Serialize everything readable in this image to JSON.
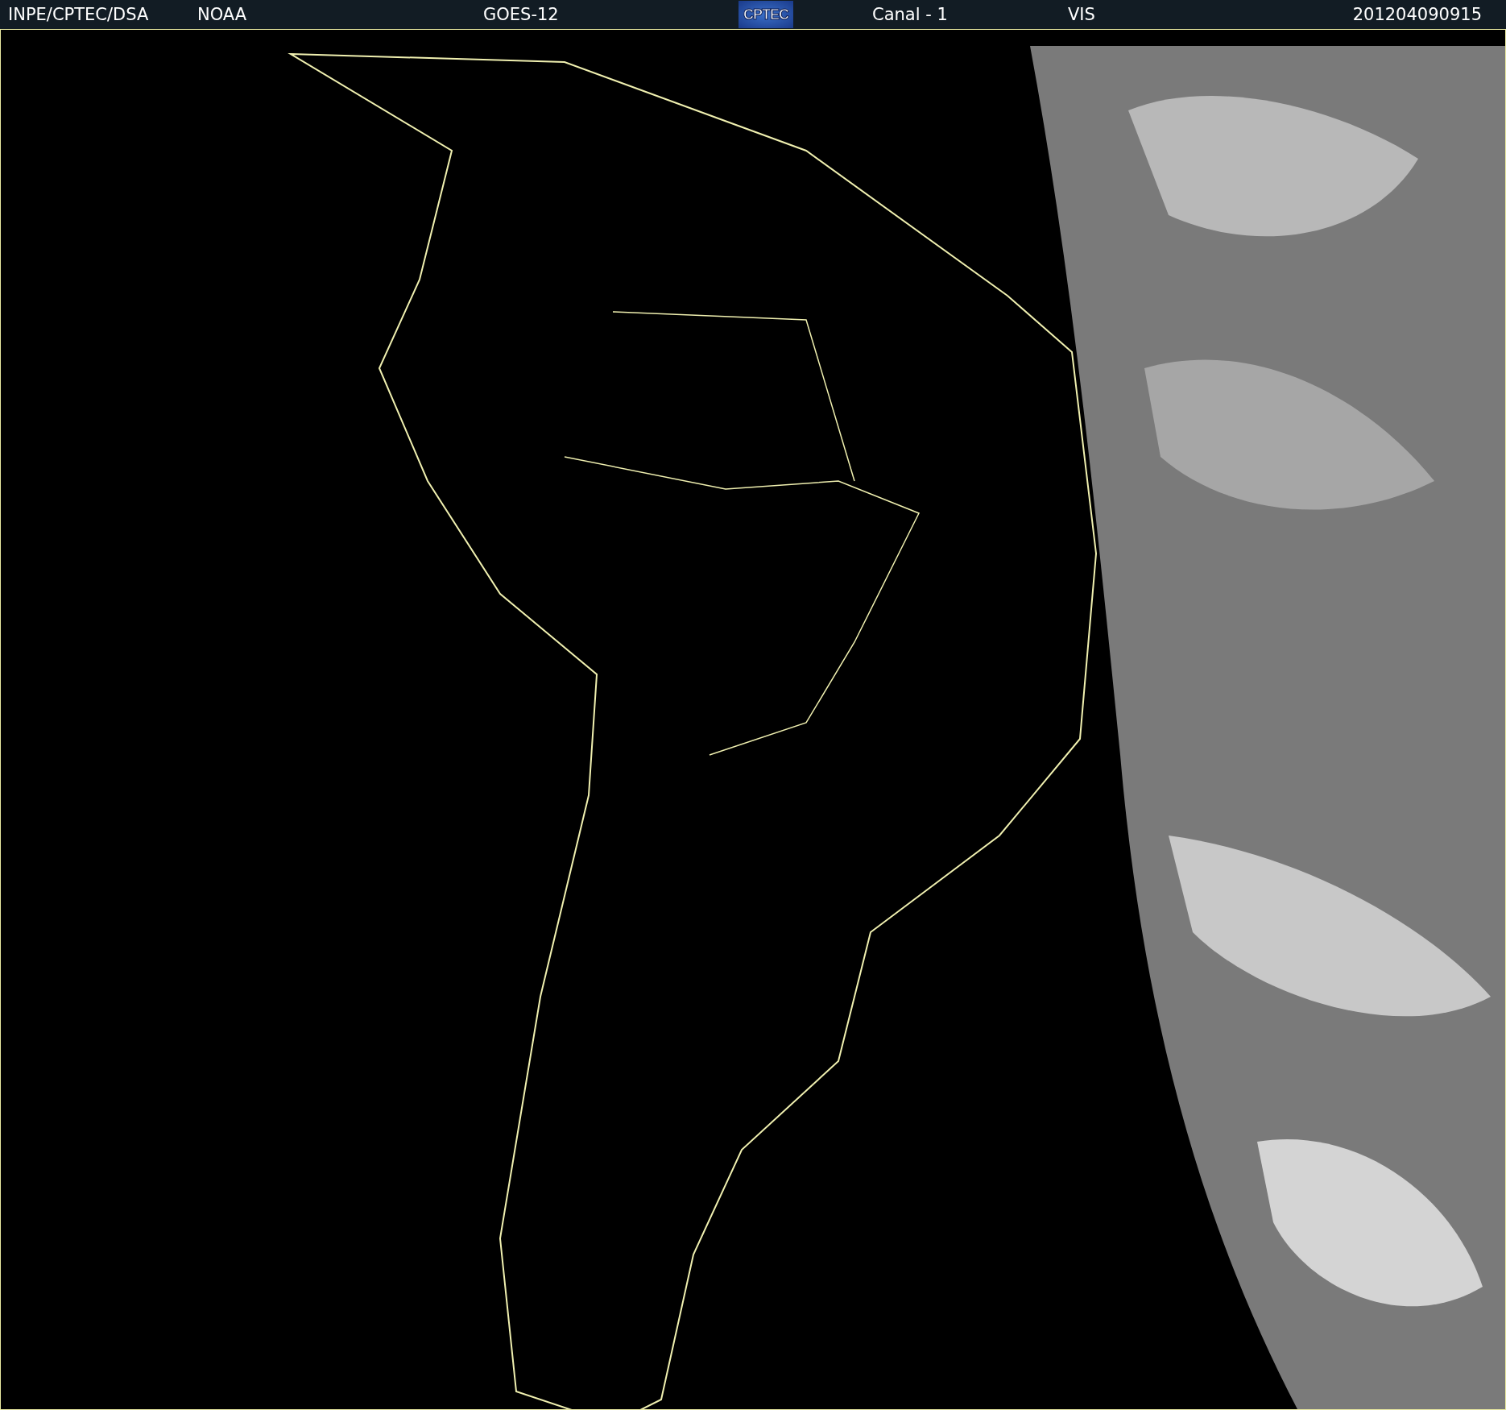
{
  "header": {
    "items": [
      {
        "kind": "text",
        "text": "INPE/CPTEC/DSA"
      },
      {
        "kind": "text",
        "text": "NOAA"
      },
      {
        "kind": "text",
        "text": "GOES-12"
      },
      {
        "kind": "logo",
        "text": "CPTEC"
      },
      {
        "kind": "text",
        "text": "Canal - 1"
      },
      {
        "kind": "text",
        "text": "VIS"
      },
      {
        "kind": "text",
        "text": "201204090915"
      }
    ]
  }
}
